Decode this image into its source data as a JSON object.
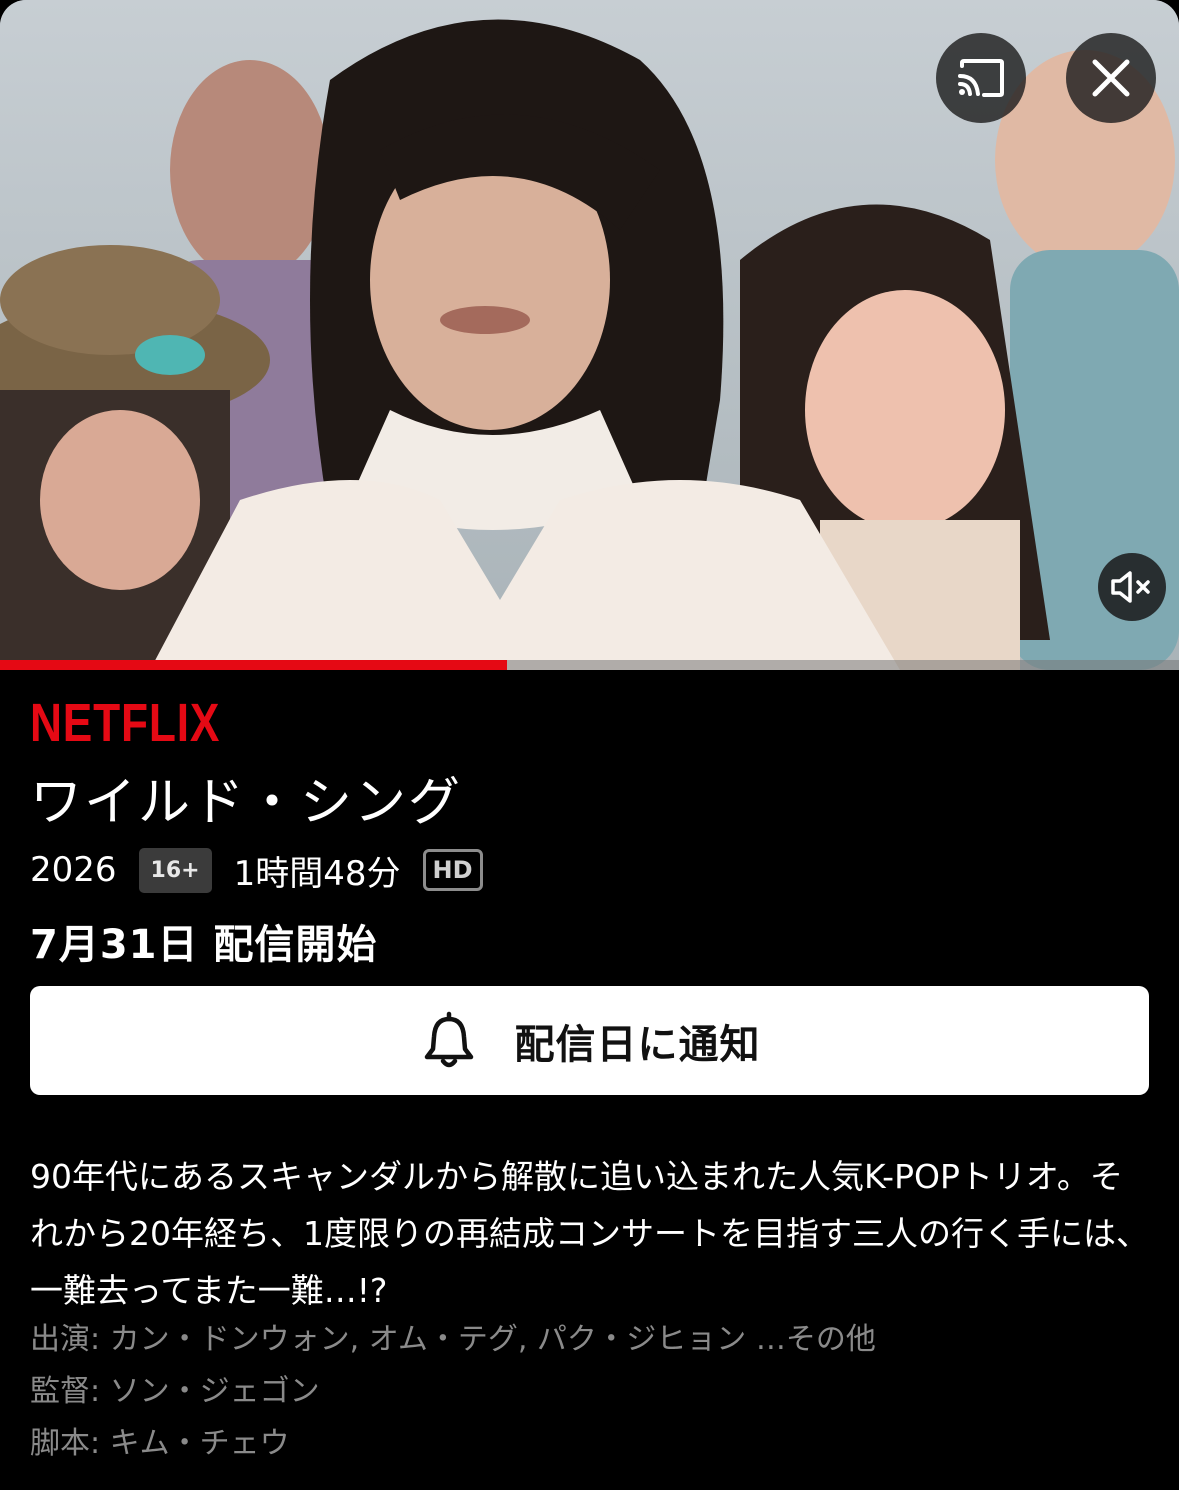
{
  "player": {
    "progress_fraction": 0.43,
    "cast_icon": "cast-icon",
    "close_icon": "close-icon",
    "mute_icon": "volume-muted-icon"
  },
  "brand": "NETFLIX",
  "title": "ワイルド・シング",
  "meta": {
    "year": "2026",
    "age_rating": "16+",
    "duration": "1時間48分",
    "quality": "HD"
  },
  "release": "7月31日 配信開始",
  "notify_button": {
    "label": "配信日に通知",
    "icon": "bell-icon"
  },
  "synopsis": "90年代にあるスキャンダルから解散に追い込まれた人気K-POPトリオ。それから20年経ち、1度限りの再結成コンサートを目指す三人の行く手には、一難去ってまた一難…!?",
  "credits": {
    "cast": "出演: カン・ドンウォン, オム・テグ, パク・ジヒョン …その他",
    "director": "監督: ソン・ジェゴン",
    "writer": "脚本: キム・チェウ"
  },
  "colors": {
    "brand_red": "#e50914",
    "background": "#000000",
    "muted_text": "#8a8a8a"
  }
}
